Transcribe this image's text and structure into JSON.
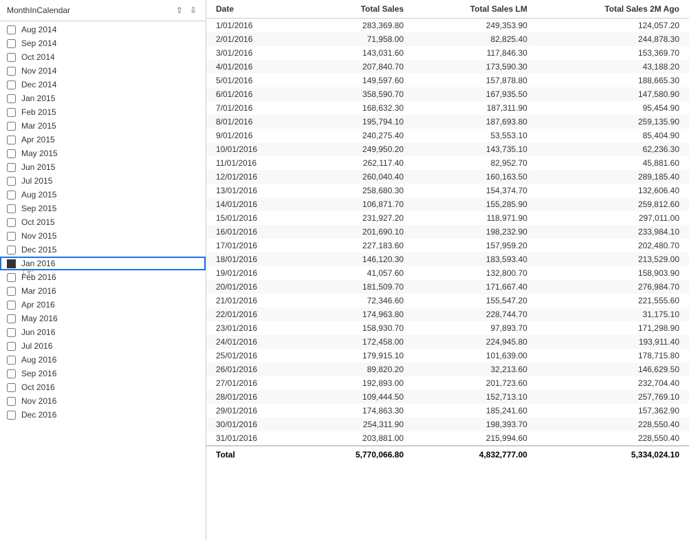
{
  "leftPanel": {
    "title": "MonthInCalendar",
    "items": [
      {
        "label": "Aug 2014",
        "checked": false,
        "selected": false
      },
      {
        "label": "Sep 2014",
        "checked": false,
        "selected": false
      },
      {
        "label": "Oct 2014",
        "checked": false,
        "selected": false
      },
      {
        "label": "Nov 2014",
        "checked": false,
        "selected": false
      },
      {
        "label": "Dec 2014",
        "checked": false,
        "selected": false
      },
      {
        "label": "Jan 2015",
        "checked": false,
        "selected": false
      },
      {
        "label": "Feb 2015",
        "checked": false,
        "selected": false
      },
      {
        "label": "Mar 2015",
        "checked": false,
        "selected": false
      },
      {
        "label": "Apr 2015",
        "checked": false,
        "selected": false
      },
      {
        "label": "May 2015",
        "checked": false,
        "selected": false
      },
      {
        "label": "Jun 2015",
        "checked": false,
        "selected": false
      },
      {
        "label": "Jul 2015",
        "checked": false,
        "selected": false
      },
      {
        "label": "Aug 2015",
        "checked": false,
        "selected": false
      },
      {
        "label": "Sep 2015",
        "checked": false,
        "selected": false
      },
      {
        "label": "Oct 2015",
        "checked": false,
        "selected": false
      },
      {
        "label": "Nov 2015",
        "checked": false,
        "selected": false
      },
      {
        "label": "Dec 2015",
        "checked": false,
        "selected": false
      },
      {
        "label": "Jan 2016",
        "checked": true,
        "selected": true
      },
      {
        "label": "Feb 2016",
        "checked": false,
        "selected": false
      },
      {
        "label": "Mar 2016",
        "checked": false,
        "selected": false
      },
      {
        "label": "Apr 2016",
        "checked": false,
        "selected": false
      },
      {
        "label": "May 2016",
        "checked": false,
        "selected": false
      },
      {
        "label": "Jun 2016",
        "checked": false,
        "selected": false
      },
      {
        "label": "Jul 2016",
        "checked": false,
        "selected": false
      },
      {
        "label": "Aug 2016",
        "checked": false,
        "selected": false
      },
      {
        "label": "Sep 2016",
        "checked": false,
        "selected": false
      },
      {
        "label": "Oct 2016",
        "checked": false,
        "selected": false
      },
      {
        "label": "Nov 2016",
        "checked": false,
        "selected": false
      },
      {
        "label": "Dec 2016",
        "checked": false,
        "selected": false
      }
    ]
  },
  "table": {
    "columns": [
      "Date",
      "Total Sales",
      "Total Sales LM",
      "Total Sales 2M Ago"
    ],
    "rows": [
      [
        "1/01/2016",
        "283,369.80",
        "249,353.90",
        "124,057.20"
      ],
      [
        "2/01/2016",
        "71,958.00",
        "82,825.40",
        "244,878.30"
      ],
      [
        "3/01/2016",
        "143,031.60",
        "117,846.30",
        "153,369.70"
      ],
      [
        "4/01/2016",
        "207,840.70",
        "173,590.30",
        "43,188.20"
      ],
      [
        "5/01/2016",
        "149,597.60",
        "157,878.80",
        "188,665.30"
      ],
      [
        "6/01/2016",
        "358,590.70",
        "167,935.50",
        "147,580.90"
      ],
      [
        "7/01/2016",
        "168,632.30",
        "187,311.90",
        "95,454.90"
      ],
      [
        "8/01/2016",
        "195,794.10",
        "187,693.80",
        "259,135.90"
      ],
      [
        "9/01/2016",
        "240,275.40",
        "53,553.10",
        "85,404.90"
      ],
      [
        "10/01/2016",
        "249,950.20",
        "143,735.10",
        "62,236.30"
      ],
      [
        "11/01/2016",
        "262,117.40",
        "82,952.70",
        "45,881.60"
      ],
      [
        "12/01/2016",
        "260,040.40",
        "160,163.50",
        "289,185.40"
      ],
      [
        "13/01/2016",
        "258,680.30",
        "154,374.70",
        "132,606.40"
      ],
      [
        "14/01/2016",
        "106,871.70",
        "155,285.90",
        "259,812.60"
      ],
      [
        "15/01/2016",
        "231,927.20",
        "118,971.90",
        "297,011.00"
      ],
      [
        "16/01/2016",
        "201,690.10",
        "198,232.90",
        "233,984.10"
      ],
      [
        "17/01/2016",
        "227,183.60",
        "157,959.20",
        "202,480.70"
      ],
      [
        "18/01/2016",
        "146,120.30",
        "183,593.40",
        "213,529.00"
      ],
      [
        "19/01/2016",
        "41,057.60",
        "132,800.70",
        "158,903.90"
      ],
      [
        "20/01/2016",
        "181,509.70",
        "171,667.40",
        "276,984.70"
      ],
      [
        "21/01/2016",
        "72,346.60",
        "155,547.20",
        "221,555.60"
      ],
      [
        "22/01/2016",
        "174,963.80",
        "228,744.70",
        "31,175.10"
      ],
      [
        "23/01/2016",
        "158,930.70",
        "97,893.70",
        "171,298.90"
      ],
      [
        "24/01/2016",
        "172,458.00",
        "224,945.80",
        "193,911.40"
      ],
      [
        "25/01/2016",
        "179,915.10",
        "101,639.00",
        "178,715.80"
      ],
      [
        "26/01/2016",
        "89,820.20",
        "32,213.60",
        "146,629.50"
      ],
      [
        "27/01/2016",
        "192,893.00",
        "201,723.60",
        "232,704.40"
      ],
      [
        "28/01/2016",
        "109,444.50",
        "152,713.10",
        "257,769.10"
      ],
      [
        "29/01/2016",
        "174,863.30",
        "185,241.60",
        "157,362.90"
      ],
      [
        "30/01/2016",
        "254,311.90",
        "198,393.70",
        "228,550.40"
      ],
      [
        "31/01/2016",
        "203,881.00",
        "215,994.60",
        "228,550.40"
      ]
    ],
    "footer": [
      "Total",
      "5,770,066.80",
      "4,832,777.00",
      "5,334,024.10"
    ]
  }
}
